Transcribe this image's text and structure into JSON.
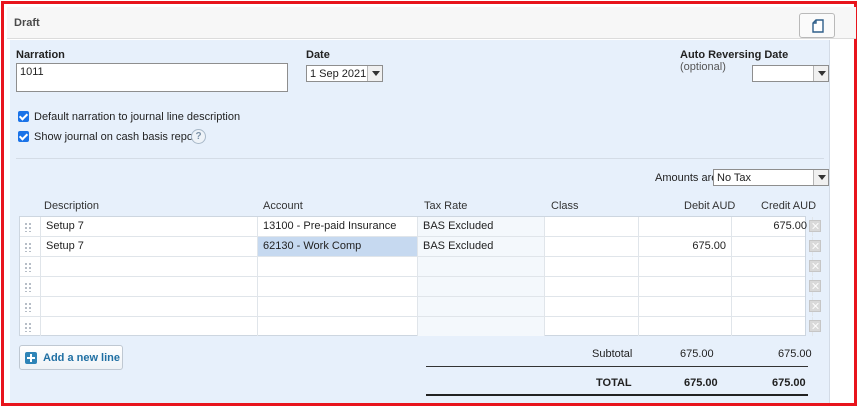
{
  "header": {
    "title": "Draft",
    "copy_icon": "copy-icon"
  },
  "form": {
    "narration_label": "Narration",
    "narration_value": "1011",
    "date_label": "Date",
    "date_value": "1 Sep 2021",
    "reversing_label": "Auto Reversing Date",
    "reversing_optional": "(optional)",
    "reversing_value": "",
    "chk_default_narration": "Default narration to journal line description",
    "chk_cash_basis": "Show journal on cash basis reports",
    "help_icon": "?"
  },
  "amounts": {
    "label": "Amounts are",
    "value": "No Tax"
  },
  "columns": {
    "description": "Description",
    "account": "Account",
    "tax_rate": "Tax Rate",
    "class": "Class",
    "debit": "Debit AUD",
    "credit": "Credit AUD"
  },
  "rows": [
    {
      "description": "Setup 7",
      "account": "13100 - Pre-paid Insurance",
      "tax_rate": "BAS Excluded",
      "class": "",
      "debit": "",
      "credit": "675.00"
    },
    {
      "description": "Setup 7",
      "account": "62130 - Work Comp",
      "tax_rate": "BAS Excluded",
      "class": "",
      "debit": "675.00",
      "credit": ""
    },
    {
      "description": "",
      "account": "",
      "tax_rate": "",
      "class": "",
      "debit": "",
      "credit": ""
    },
    {
      "description": "",
      "account": "",
      "tax_rate": "",
      "class": "",
      "debit": "",
      "credit": ""
    },
    {
      "description": "",
      "account": "",
      "tax_rate": "",
      "class": "",
      "debit": "",
      "credit": ""
    },
    {
      "description": "",
      "account": "",
      "tax_rate": "",
      "class": "",
      "debit": "",
      "credit": ""
    }
  ],
  "add_line": "Add a new line",
  "totals": {
    "subtotal_label": "Subtotal",
    "subtotal_debit": "675.00",
    "subtotal_credit": "675.00",
    "total_label": "TOTAL",
    "total_debit": "675.00",
    "total_credit": "675.00"
  }
}
